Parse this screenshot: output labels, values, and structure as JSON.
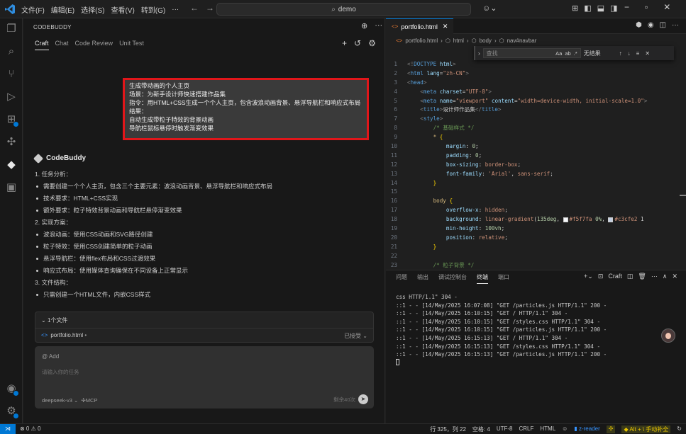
{
  "titlebar": {
    "menus": [
      "文件(F)",
      "编辑(E)",
      "选择(S)",
      "查看(V)",
      "转到(G)",
      "···"
    ],
    "search_text": "demo"
  },
  "sidepanel": {
    "title": "CODEBUDDY",
    "tabs": [
      {
        "label": "Craft",
        "active": true
      },
      {
        "label": "Chat",
        "active": false
      },
      {
        "label": "Code Review",
        "active": false
      },
      {
        "label": "Unit Test",
        "active": false
      }
    ],
    "prompt_lines": [
      "生成带动画的个人主页",
      "场景：为新手设计师快速搭建作品集",
      "指令：用HTML+CSS生成一个个人主页，包含波浪动画背景、悬浮导航栏和响应式布局",
      "结果：",
      "自动生成带粒子特效的背景动画",
      "导航栏鼠标悬停时触发渐变效果"
    ],
    "assistant_name": "CodeBuddy",
    "answer": [
      {
        "text": "1. 任务分析：",
        "bullet": false
      },
      {
        "text": "需要创建一个个人主页，包含三个主要元素：波浪动画背景、悬浮导航栏和响应式布局",
        "bullet": true
      },
      {
        "text": "技术要求：HTML+CSS实现",
        "bullet": true
      },
      {
        "text": "额外要求：粒子特效背景动画和导航栏悬停渐变效果",
        "bullet": true
      },
      {
        "text": "2. 实现方案：",
        "bullet": false
      },
      {
        "text": "波浪动画：使用CSS动画和SVG路径创建",
        "bullet": true
      },
      {
        "text": "粒子特效：使用CSS创建简单的粒子动画",
        "bullet": true
      },
      {
        "text": "悬浮导航栏：使用flex布局和CSS过渡效果",
        "bullet": true
      },
      {
        "text": "响应式布局：使用媒体查询确保在不同设备上正常显示",
        "bullet": true
      },
      {
        "text": "3. 文件结构：",
        "bullet": false
      },
      {
        "text": "只需创建一个HTML文件，内嵌CSS样式",
        "bullet": true
      }
    ],
    "files_header": "1个文件",
    "file_name": "portfolio.html",
    "file_dot": "•",
    "file_status": "已接受",
    "input_add": "@ Add",
    "input_placeholder": "请输入你的任务",
    "model": "deepseek-v3",
    "mcp": "MCP",
    "remaining": "剩余40次"
  },
  "editor": {
    "tab_label": "portfolio.html",
    "breadcrumb": [
      "portfolio.html",
      "html",
      "body",
      "nav#navbar"
    ],
    "find": {
      "placeholder": "查找",
      "options": [
        "Aa",
        "ab",
        ".*"
      ],
      "result": "无结果"
    }
  },
  "code_lines": [
    [
      [
        "ang",
        "<!"
      ],
      [
        "tag",
        "DOCTYPE"
      ],
      [
        "txt",
        " "
      ],
      [
        "attr",
        "html"
      ],
      [
        "ang",
        ">"
      ]
    ],
    [
      [
        "ang",
        "<"
      ],
      [
        "tag",
        "html"
      ],
      [
        "txt",
        " "
      ],
      [
        "attr",
        "lang"
      ],
      [
        "txt",
        "="
      ],
      [
        "str",
        "\"zh-CN\""
      ],
      [
        "ang",
        ">"
      ]
    ],
    [
      [
        "ang",
        "<"
      ],
      [
        "tag",
        "head"
      ],
      [
        "ang",
        ">"
      ]
    ],
    [
      [
        "txt",
        "    "
      ],
      [
        "ang",
        "<"
      ],
      [
        "tag",
        "meta"
      ],
      [
        "txt",
        " "
      ],
      [
        "attr",
        "charset"
      ],
      [
        "txt",
        "="
      ],
      [
        "str",
        "\"UTF-8\""
      ],
      [
        "ang",
        ">"
      ]
    ],
    [
      [
        "txt",
        "    "
      ],
      [
        "ang",
        "<"
      ],
      [
        "tag",
        "meta"
      ],
      [
        "txt",
        " "
      ],
      [
        "attr",
        "name"
      ],
      [
        "txt",
        "="
      ],
      [
        "str",
        "\"viewport\""
      ],
      [
        "txt",
        " "
      ],
      [
        "attr",
        "content"
      ],
      [
        "txt",
        "="
      ],
      [
        "str",
        "\"width=device-width, initial-scale=1.0\""
      ],
      [
        "ang",
        ">"
      ]
    ],
    [
      [
        "txt",
        "    "
      ],
      [
        "ang",
        "<"
      ],
      [
        "tag",
        "title"
      ],
      [
        "ang",
        ">"
      ],
      [
        "txt",
        "设计师作品集"
      ],
      [
        "ang",
        "</"
      ],
      [
        "tag",
        "title"
      ],
      [
        "ang",
        ">"
      ]
    ],
    [
      [
        "txt",
        "    "
      ],
      [
        "ang",
        "<"
      ],
      [
        "tag",
        "style"
      ],
      [
        "ang",
        ">"
      ]
    ],
    [
      [
        "txt",
        "        "
      ],
      [
        "com",
        "/* 基础样式 */"
      ]
    ],
    [
      [
        "txt",
        "        "
      ],
      [
        "sel",
        "* "
      ],
      [
        "brk",
        "{"
      ]
    ],
    [
      [
        "txt",
        "            "
      ],
      [
        "prop",
        "margin"
      ],
      [
        "txt",
        ": "
      ],
      [
        "num",
        "0"
      ],
      [
        "txt",
        ";"
      ]
    ],
    [
      [
        "txt",
        "            "
      ],
      [
        "prop",
        "padding"
      ],
      [
        "txt",
        ": "
      ],
      [
        "num",
        "0"
      ],
      [
        "txt",
        ";"
      ]
    ],
    [
      [
        "txt",
        "            "
      ],
      [
        "prop",
        "box-sizing"
      ],
      [
        "txt",
        ": "
      ],
      [
        "val",
        "border-box"
      ],
      [
        "txt",
        ";"
      ]
    ],
    [
      [
        "txt",
        "            "
      ],
      [
        "prop",
        "font-family"
      ],
      [
        "txt",
        ": "
      ],
      [
        "val",
        "'Arial'"
      ],
      [
        "txt",
        ", "
      ],
      [
        "val",
        "sans-serif"
      ],
      [
        "txt",
        ";"
      ]
    ],
    [
      [
        "txt",
        "        "
      ],
      [
        "brk",
        "}"
      ]
    ],
    [],
    [
      [
        "txt",
        "        "
      ],
      [
        "sel",
        "body "
      ],
      [
        "brk",
        "{"
      ]
    ],
    [
      [
        "txt",
        "            "
      ],
      [
        "prop",
        "overflow-x"
      ],
      [
        "txt",
        ": "
      ],
      [
        "val",
        "hidden"
      ],
      [
        "txt",
        ";"
      ]
    ],
    [
      [
        "txt",
        "            "
      ],
      [
        "prop",
        "background"
      ],
      [
        "txt",
        ": "
      ],
      [
        "val",
        "linear-gradient"
      ],
      [
        "txt",
        "("
      ],
      [
        "num",
        "135deg"
      ],
      [
        "txt",
        ", "
      ],
      [
        "sw1",
        ""
      ],
      [
        "val",
        "#f5f7fa"
      ],
      [
        "txt",
        " "
      ],
      [
        "num",
        "0%"
      ],
      [
        "txt",
        ", "
      ],
      [
        "sw2",
        ""
      ],
      [
        "val",
        "#c3cfe2"
      ],
      [
        "txt",
        " 1"
      ]
    ],
    [
      [
        "txt",
        "            "
      ],
      [
        "prop",
        "min-height"
      ],
      [
        "txt",
        ": "
      ],
      [
        "num",
        "100vh"
      ],
      [
        "txt",
        ";"
      ]
    ],
    [
      [
        "txt",
        "            "
      ],
      [
        "prop",
        "position"
      ],
      [
        "txt",
        ": "
      ],
      [
        "val",
        "relative"
      ],
      [
        "txt",
        ";"
      ]
    ],
    [
      [
        "txt",
        "        "
      ],
      [
        "brk",
        "}"
      ]
    ],
    [],
    [
      [
        "txt",
        "        "
      ],
      [
        "com",
        "/* 粒子背景 */"
      ]
    ]
  ],
  "panel": {
    "tabs": [
      {
        "label": "问题",
        "active": false
      },
      {
        "label": "输出",
        "active": false
      },
      {
        "label": "调试控制台",
        "active": false
      },
      {
        "label": "终端",
        "active": true
      },
      {
        "label": "端口",
        "active": false
      }
    ],
    "terminal_name": "Craft",
    "terminal_lines": [
      "css HTTP/1.1\" 304 -",
      "::1 - - [14/May/2025 16:07:08] \"GET /particles.js HTTP/1.1\" 200 -",
      "::1 - - [14/May/2025 16:10:15] \"GET / HTTP/1.1\" 304 -",
      "::1 - - [14/May/2025 16:10:15] \"GET /styles.css HTTP/1.1\" 304 -",
      "::1 - - [14/May/2025 16:10:15] \"GET /particles.js HTTP/1.1\" 200 -",
      "::1 - - [14/May/2025 16:15:13] \"GET / HTTP/1.1\" 304 -",
      "::1 - - [14/May/2025 16:15:13] \"GET /styles.css HTTP/1.1\" 304 -",
      "::1 - - [14/May/2025 16:15:13] \"GET /particles.js HTTP/1.1\" 200 -"
    ]
  },
  "statusbar": {
    "problems": "⊗ 0 ⚠ 0",
    "position": "行 325，列 22",
    "spaces": "空格: 4",
    "encoding": "UTF-8",
    "eol": "CRLF",
    "language": "HTML",
    "reader": "z-reader",
    "shortcut": "Alt + \\ 手动补全"
  },
  "colors": {
    "accent": "#0078d4",
    "highlight_border": "#e0161a",
    "background": "#1f1f1f"
  }
}
